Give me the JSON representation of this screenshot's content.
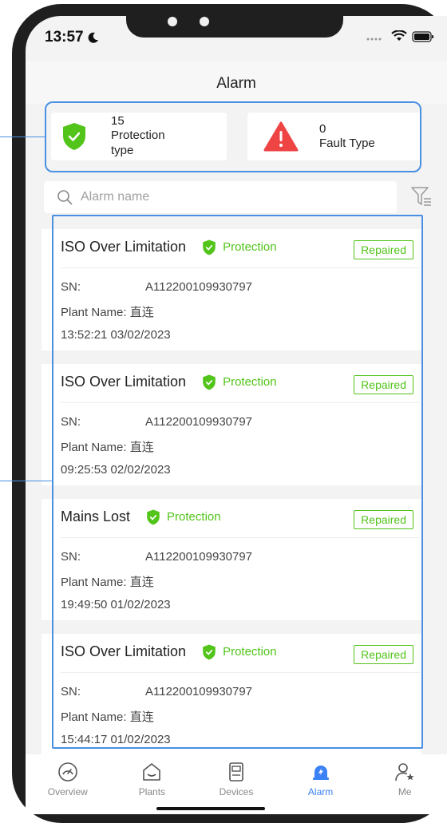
{
  "status_bar": {
    "time": "13:57"
  },
  "header": {
    "title": "Alarm"
  },
  "summary": {
    "protection": {
      "count": "15",
      "label_line1": "Protection",
      "label_line2": "type"
    },
    "fault": {
      "count": "0",
      "label": "Fault Type"
    }
  },
  "search": {
    "placeholder": "Alarm name"
  },
  "alarms": [
    {
      "title": "ISO Over Limitation",
      "type": "Protection",
      "status": "Repaired",
      "sn_label": "SN:",
      "sn": "A112200109930797",
      "plant_label": "Plant Name:",
      "plant": "直连",
      "timestamp": "13:52:21 03/02/2023"
    },
    {
      "title": "ISO Over Limitation",
      "type": "Protection",
      "status": "Repaired",
      "sn_label": "SN:",
      "sn": "A112200109930797",
      "plant_label": "Plant Name:",
      "plant": "直连",
      "timestamp": "09:25:53 02/02/2023"
    },
    {
      "title": "Mains Lost",
      "type": "Protection",
      "status": "Repaired",
      "sn_label": "SN:",
      "sn": "A112200109930797",
      "plant_label": "Plant Name:",
      "plant": "直连",
      "timestamp": "19:49:50 01/02/2023"
    },
    {
      "title": "ISO Over Limitation",
      "type": "Protection",
      "status": "Repaired",
      "sn_label": "SN:",
      "sn": "A112200109930797",
      "plant_label": "Plant Name:",
      "plant": "直连",
      "timestamp": "15:44:17 01/02/2023"
    }
  ],
  "tabs": [
    {
      "label": "Overview",
      "icon": "gauge-icon",
      "active": false
    },
    {
      "label": "Plants",
      "icon": "house-icon",
      "active": false
    },
    {
      "label": "Devices",
      "icon": "device-icon",
      "active": false
    },
    {
      "label": "Alarm",
      "icon": "alarm-icon",
      "active": true
    },
    {
      "label": "Me",
      "icon": "user-icon",
      "active": false
    }
  ],
  "colors": {
    "accent": "#3b82f6",
    "protection_green": "#52c41a",
    "fault_red": "#ef4444",
    "highlight_blue": "#4a90e2"
  }
}
